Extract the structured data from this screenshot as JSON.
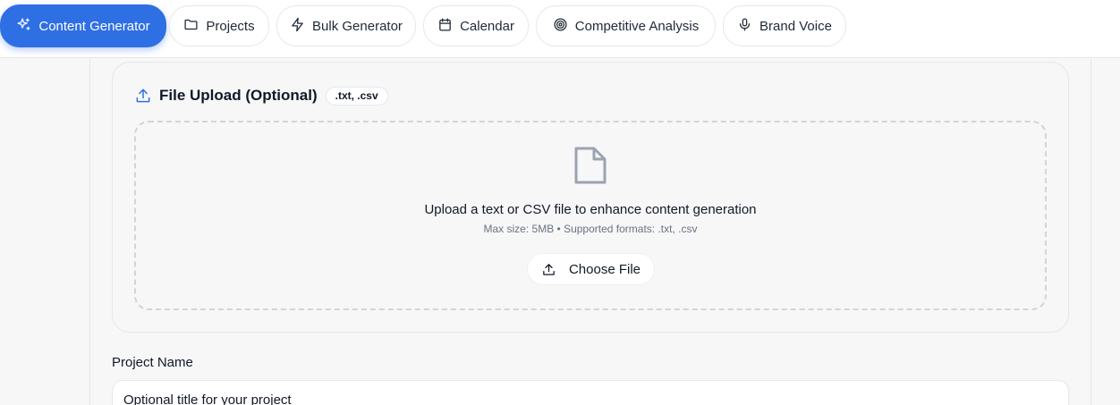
{
  "nav": {
    "tabs": [
      {
        "label": "Content Generator",
        "icon": "sparkles-icon",
        "active": true
      },
      {
        "label": "Projects",
        "icon": "folder-icon",
        "active": false
      },
      {
        "label": "Bulk Generator",
        "icon": "lightning-icon",
        "active": false
      },
      {
        "label": "Calendar",
        "icon": "calendar-icon",
        "active": false
      },
      {
        "label": "Competitive Analysis",
        "icon": "target-icon",
        "active": false
      },
      {
        "label": "Brand Voice",
        "icon": "microphone-icon",
        "active": false
      }
    ]
  },
  "upload": {
    "title": "File Upload (Optional)",
    "badge": ".txt, .csv",
    "dropzone_title": "Upload a text or CSV file to enhance content generation",
    "dropzone_subtitle": "Max size: 5MB • Supported formats: .txt, .csv",
    "choose_label": "Choose File"
  },
  "project": {
    "label": "Project Name",
    "placeholder": "Optional title for your project",
    "value": ""
  },
  "colors": {
    "accent": "#2f6fe4",
    "background": "#f7f7f8",
    "border": "#e5e7eb"
  }
}
